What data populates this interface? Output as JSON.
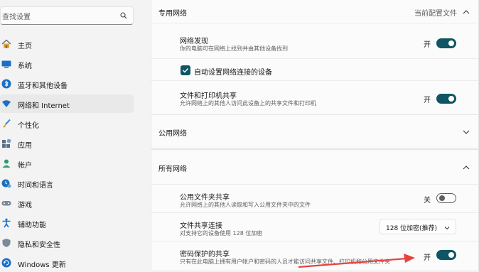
{
  "search": {
    "placeholder": "查找设置"
  },
  "sidebar": {
    "items": [
      {
        "label": "主页",
        "icon": "home-icon"
      },
      {
        "label": "系统",
        "icon": "system-icon"
      },
      {
        "label": "蓝牙和其他设备",
        "icon": "bluetooth-icon"
      },
      {
        "label": "网络和 Internet",
        "icon": "network-icon",
        "active": true
      },
      {
        "label": "个性化",
        "icon": "brush-icon"
      },
      {
        "label": "应用",
        "icon": "apps-icon"
      },
      {
        "label": "帐户",
        "icon": "account-icon"
      },
      {
        "label": "时间和语言",
        "icon": "time-language-icon"
      },
      {
        "label": "游戏",
        "icon": "gaming-icon"
      },
      {
        "label": "辅助功能",
        "icon": "accessibility-icon"
      },
      {
        "label": "隐私和安全性",
        "icon": "shield-icon"
      },
      {
        "label": "Windows 更新",
        "icon": "update-icon"
      }
    ]
  },
  "private_network": {
    "title": "专用网络",
    "header_right": "当前配置文件",
    "discovery": {
      "title": "网络发现",
      "subtitle": "你的电脑可在网络上找到并由其他设备找到",
      "state_label": "开"
    },
    "auto_setup": {
      "label": "自动设置网络连接的设备"
    },
    "sharing": {
      "title": "文件和打印机共享",
      "subtitle": "允许网络上的其他人访问此设备上的共享文件和打印机",
      "state_label": "开"
    }
  },
  "public_network": {
    "title": "公用网络"
  },
  "all_networks": {
    "title": "所有网络",
    "public_folder": {
      "title": "公用文件夹共享",
      "subtitle": "允许网络上的其他人读取和写入公用文件夹中的文件",
      "state_label": "关"
    },
    "file_sharing_conn": {
      "title": "文件共享连接",
      "subtitle": "对支持它的设备使用 128 位加密",
      "value": "128 位加密(推荐)"
    },
    "password_protected": {
      "title": "密码保护的共享",
      "subtitle": "只有在此电脑上拥有用户帐户和密码的人员才能访问共享文件、打印机和公用文件夹",
      "state_label": "开"
    }
  },
  "colors": {
    "accent": "#0f5563",
    "arrow": "#e8423f"
  }
}
